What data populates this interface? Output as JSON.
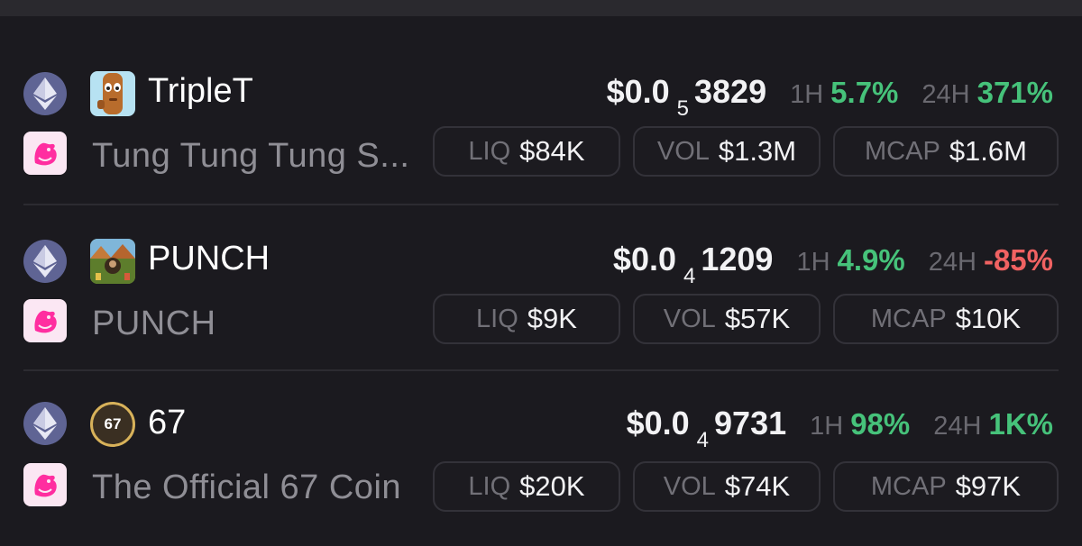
{
  "colors": {
    "background": "#1b1a1f",
    "positive": "#46c27a",
    "negative": "#f06262",
    "ethereum": "#5f6494",
    "uniswap": "#ff2ea0"
  },
  "icons": {
    "chain": "ethereum-icon",
    "dex": "uniswap-icon"
  },
  "tokens": [
    {
      "symbol": "TripleT",
      "name": "Tung Tung Tung S...",
      "price_prefix": "$0.0",
      "price_zeros": "5",
      "price_digits": "3829",
      "h1_label": "1H",
      "h1": "5.7%",
      "h24_label": "24H",
      "h24": "371%",
      "liq_label": "LIQ",
      "liq": "$84K",
      "vol_label": "VOL",
      "vol": "$1.3M",
      "mcap_label": "MCAP",
      "mcap": "$1.6M"
    },
    {
      "symbol": "PUNCH",
      "name": "PUNCH",
      "price_prefix": "$0.0",
      "price_zeros": "4",
      "price_digits": "1209",
      "h1_label": "1H",
      "h1": "4.9%",
      "h24_label": "24H",
      "h24": "-85%",
      "liq_label": "LIQ",
      "liq": "$9K",
      "vol_label": "VOL",
      "vol": "$57K",
      "mcap_label": "MCAP",
      "mcap": "$10K"
    },
    {
      "symbol": "67",
      "name": "The Official 67 Coin",
      "avatar_text": "67",
      "price_prefix": "$0.0",
      "price_zeros": "4",
      "price_digits": "9731",
      "h1_label": "1H",
      "h1": "98%",
      "h24_label": "24H",
      "h24": "1K%",
      "liq_label": "LIQ",
      "liq": "$20K",
      "vol_label": "VOL",
      "vol": "$74K",
      "mcap_label": "MCAP",
      "mcap": "$97K"
    }
  ]
}
